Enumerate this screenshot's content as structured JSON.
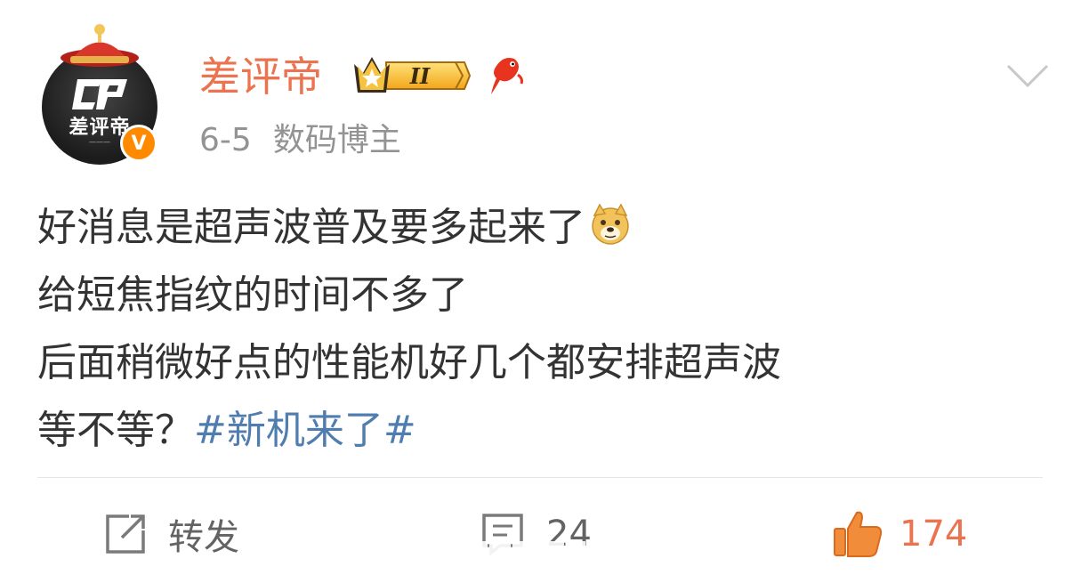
{
  "author": {
    "name": "差评帝",
    "avatar_text": "差评帝",
    "avatar_logo": "CP",
    "verified_mark": "V",
    "level_badge": "II",
    "date": "6-5",
    "tag": "数码博主"
  },
  "post": {
    "lines": [
      "好消息是超声波普及要多起来了",
      "给短焦指纹的时间不多了",
      "后面稍微好点的性能机好几个都安排超声波",
      "等不等？"
    ],
    "topic": "#新机来了#"
  },
  "actions": {
    "repost_label": "转发",
    "comment_count": "24",
    "like_count": "174"
  },
  "colors": {
    "username": "#eb7350",
    "topic_link": "#507daf",
    "like": "#eb7350",
    "badge": "#ff8a00"
  },
  "icons": [
    "crown-badge-icon",
    "fish-icon",
    "chevron-down-icon",
    "doge-emoji-icon",
    "repost-icon",
    "comment-icon",
    "like-icon"
  ]
}
